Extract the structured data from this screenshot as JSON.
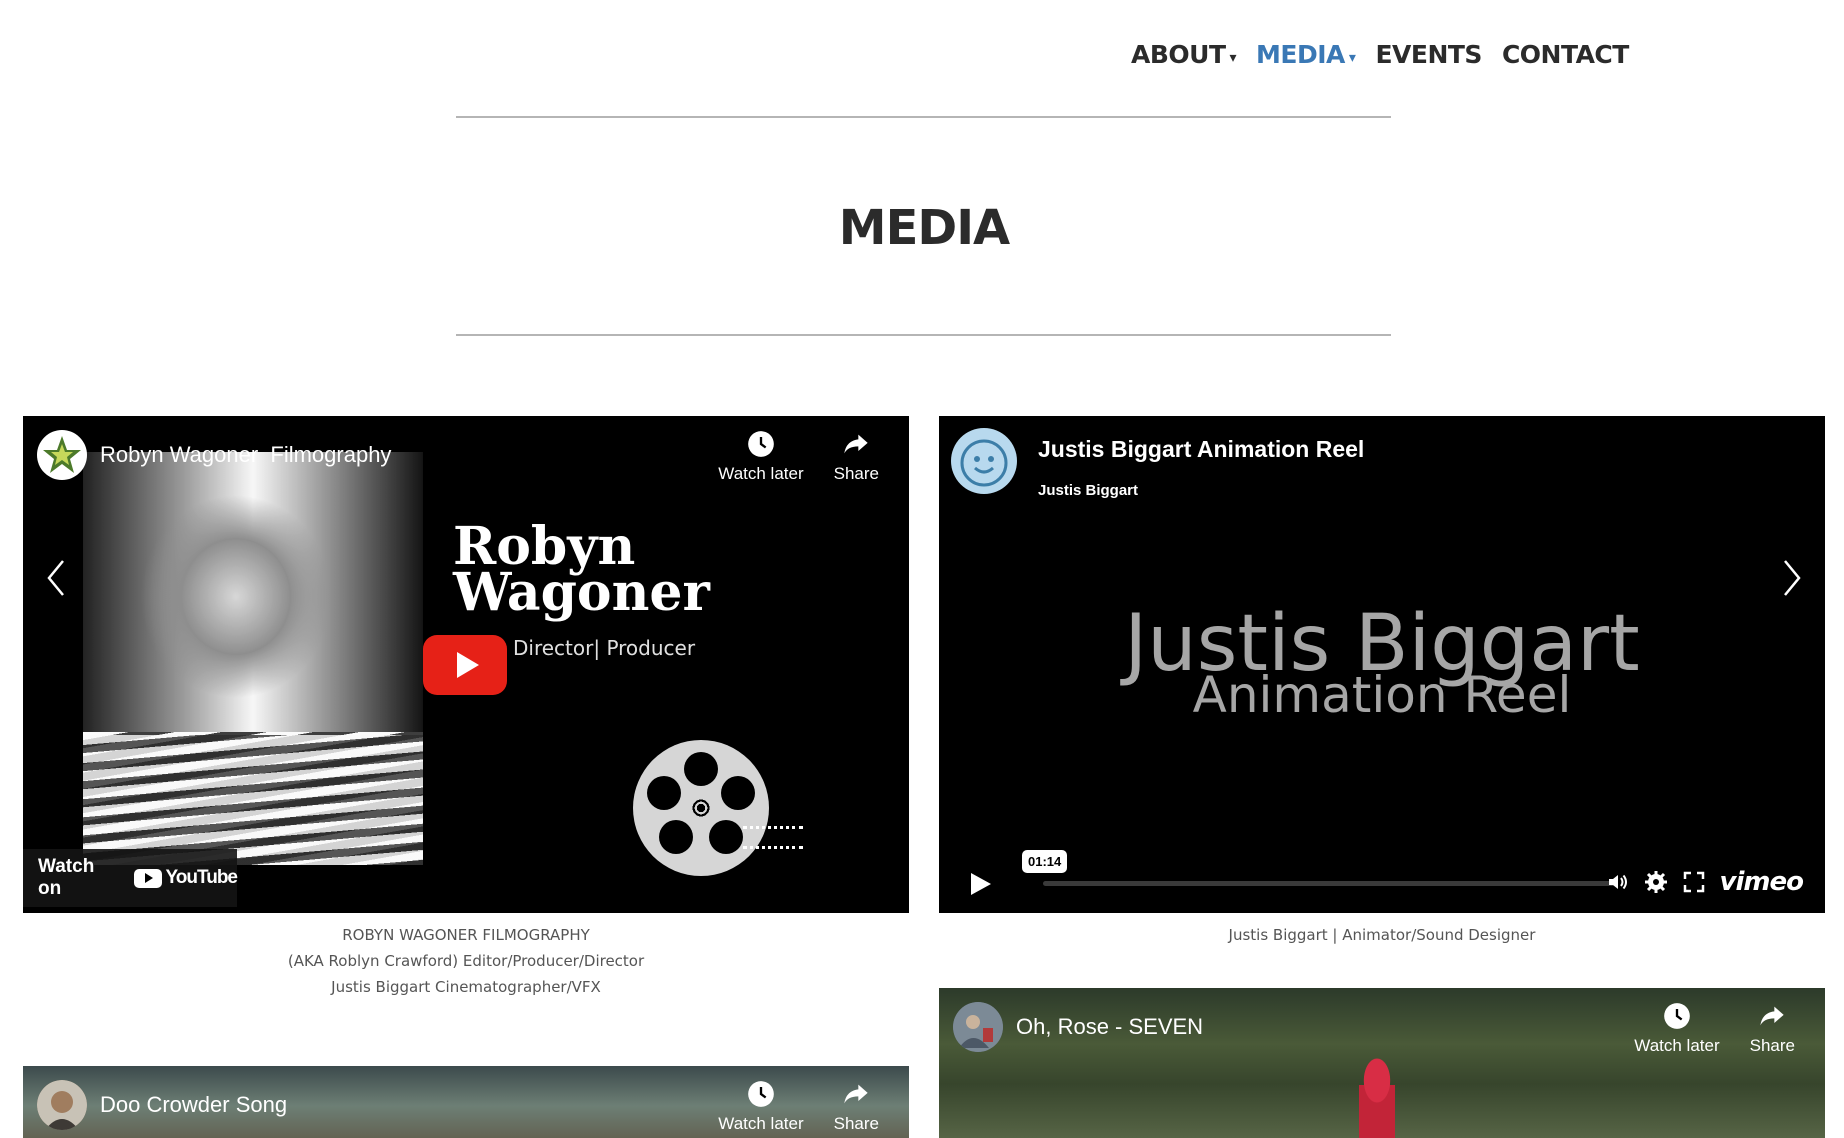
{
  "nav": {
    "items": [
      {
        "label": "ABOUT",
        "has_dropdown": true,
        "active": false
      },
      {
        "label": "MEDIA",
        "has_dropdown": true,
        "active": true
      },
      {
        "label": "EVENTS",
        "has_dropdown": false,
        "active": false
      },
      {
        "label": "CONTACT",
        "has_dropdown": false,
        "active": false
      }
    ],
    "caret": "▾",
    "active_color": "#3a78b5"
  },
  "page": {
    "title": "MEDIA"
  },
  "videos": [
    {
      "provider": "youtube",
      "title": "Robyn Wagoner  Filmography",
      "watch_later": "Watch later",
      "share": "Share",
      "overlay_name": [
        "Robyn",
        "Wagoner"
      ],
      "overlay_subtitle": "Director| Producer",
      "watch_on": "Watch on",
      "youtube_logo": "YouTube",
      "caption": [
        "ROBYN WAGONER FILMOGRAPHY",
        "(AKA Roblyn Crawford) Editor/Producer/Director",
        "Justis Biggart Cinematographer/VFX"
      ]
    },
    {
      "provider": "vimeo",
      "title": "Justis Biggart Animation Reel",
      "author": "Justis Biggart",
      "overlay_line1": "Justis Biggart",
      "overlay_line2": "Animation Reel",
      "time": "01:14",
      "vimeo_logo": "vimeo",
      "caption": [
        "Justis Biggart | Animator/Sound Designer"
      ]
    },
    {
      "provider": "youtube",
      "title": "Doo Crowder Song",
      "watch_later": "Watch later",
      "share": "Share"
    },
    {
      "provider": "youtube",
      "title": "Oh, Rose - SEVEN",
      "watch_later": "Watch later",
      "share": "Share"
    }
  ],
  "icons": {
    "clock": "clock-icon",
    "share": "share-arrow-icon",
    "chevron_left": "chevron-left-icon",
    "chevron_right": "chevron-right-icon",
    "volume": "volume-icon",
    "settings": "gear-icon",
    "fullscreen": "fullscreen-icon",
    "play": "play-icon"
  },
  "colors": {
    "youtube_red": "#e62117",
    "text_dark": "#2b2b2b",
    "rule": "#b5b5b5"
  }
}
